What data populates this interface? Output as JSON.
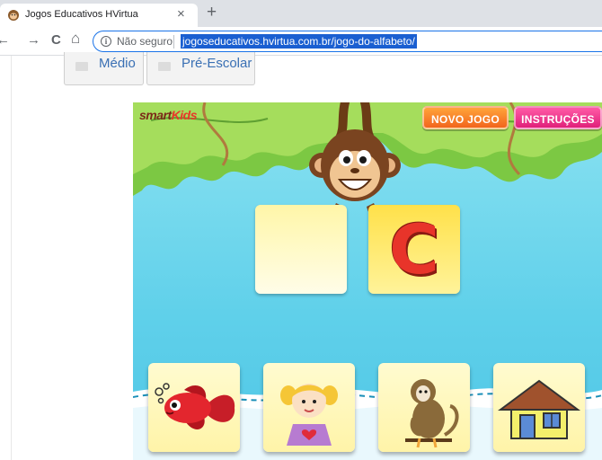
{
  "browser": {
    "tab_title": "Jogos Educativos HVirtua",
    "tab_close": "×",
    "new_tab": "+",
    "nav": {
      "back": "←",
      "forward": "→",
      "reload": "C",
      "home": "⌂"
    },
    "security_label": "Não seguro",
    "url": "jogoseducativos.hvirtua.com.br/jogo-do-alfabeto/"
  },
  "categories": [
    {
      "label": "Médio"
    },
    {
      "label": "Pré-Escolar"
    }
  ],
  "game": {
    "logo_part1": "smart",
    "logo_part2": "Kids",
    "buttons": {
      "new_game": "NOVO JOGO",
      "instructions": "INSTRUÇÕES"
    },
    "answer_letter": "C",
    "choices": [
      {
        "icon": "fish-icon"
      },
      {
        "icon": "girl-icon"
      },
      {
        "icon": "monkey-icon"
      },
      {
        "icon": "house-icon"
      }
    ],
    "colors": {
      "sky": "#5fd0ea",
      "leaves": "#8fd14a",
      "new_game_button": "#f2651d",
      "instructions_button": "#e0207a",
      "letter": "#e8342a"
    }
  }
}
